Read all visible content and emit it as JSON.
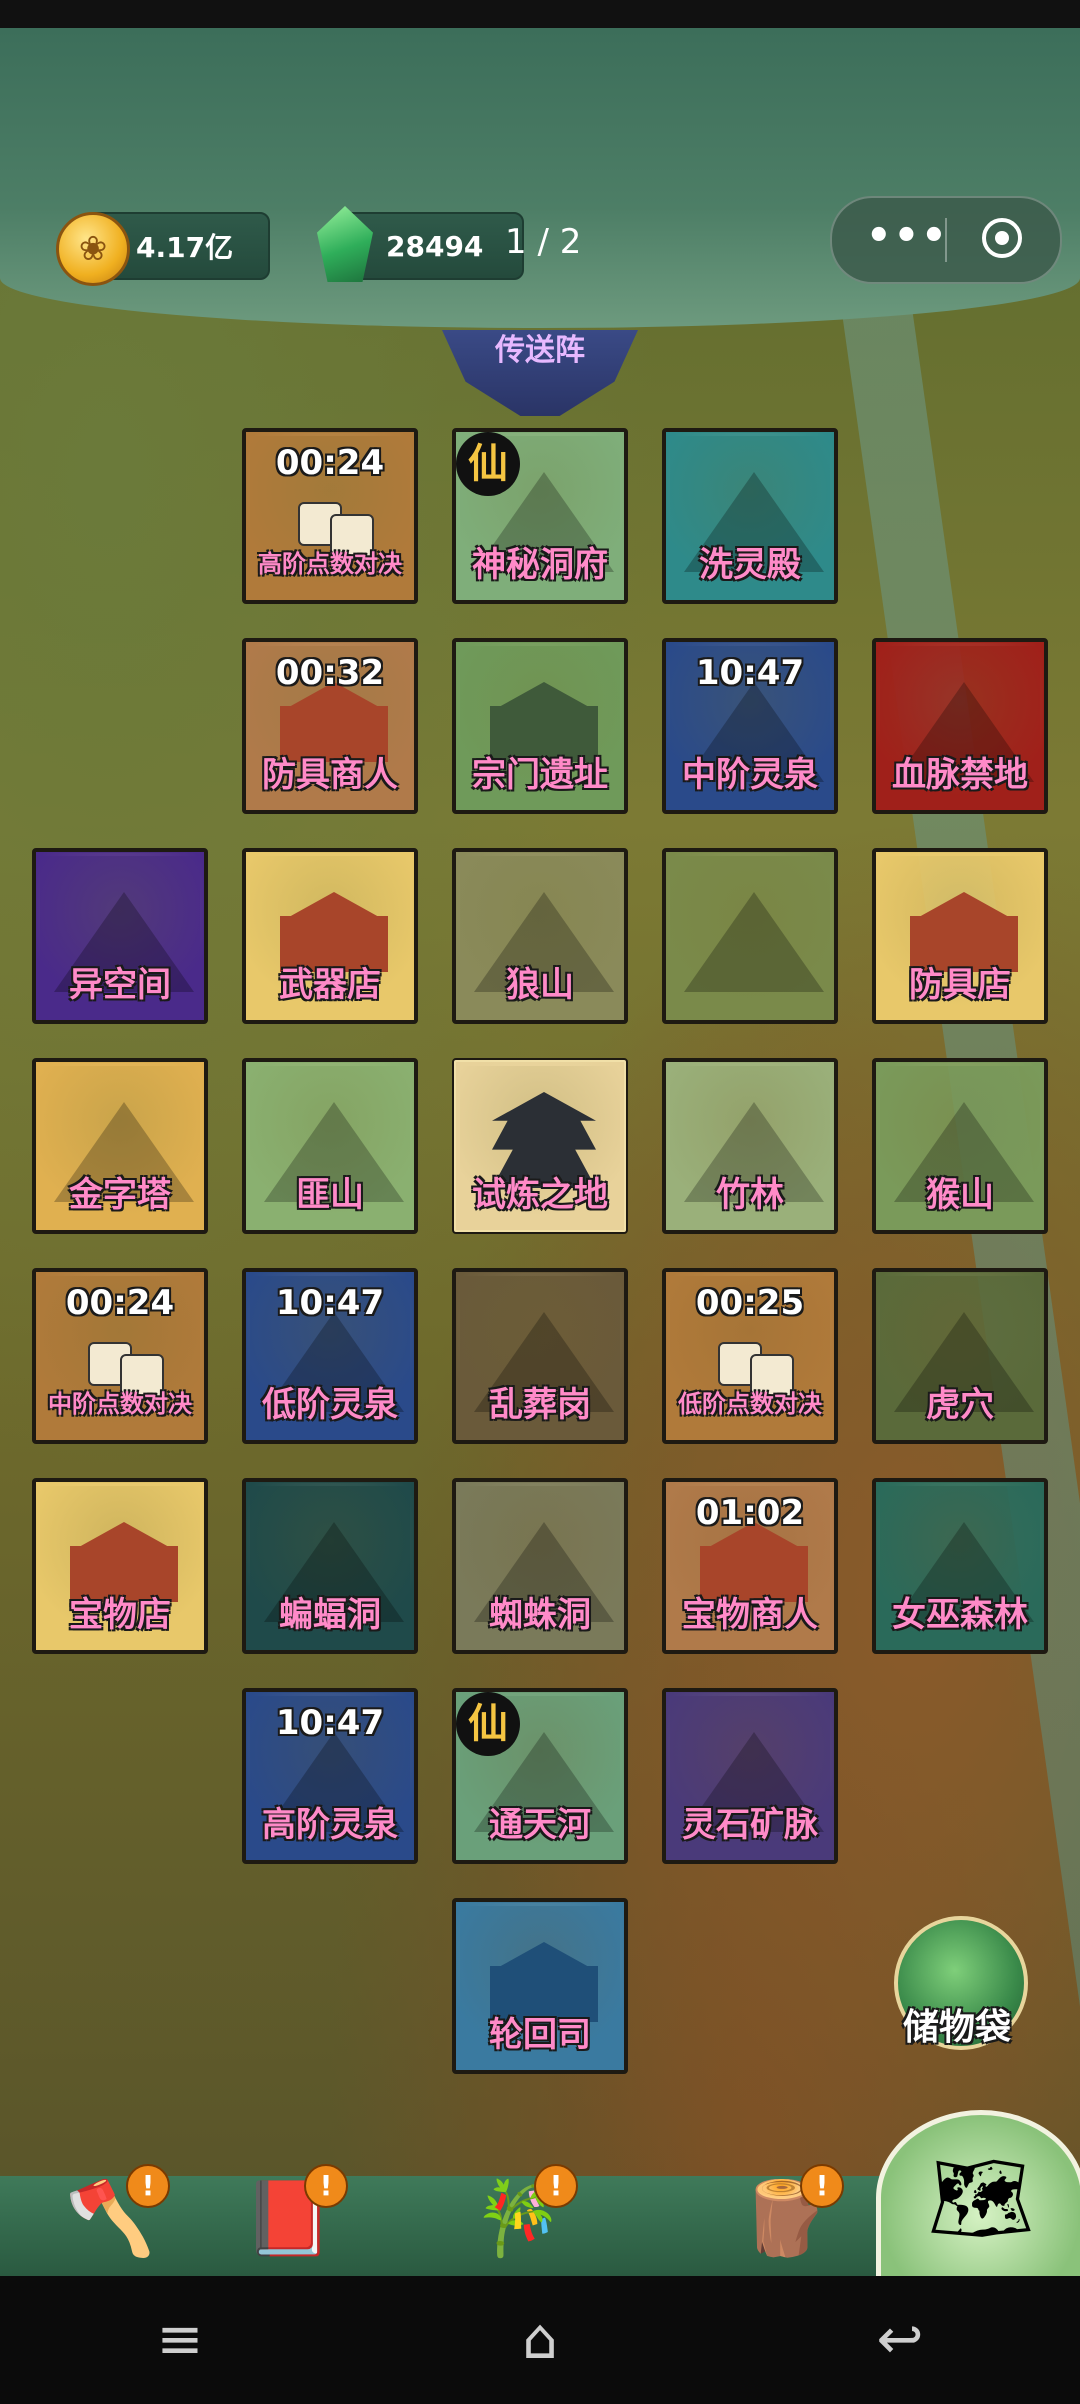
{
  "resources": {
    "coins": "4.17亿",
    "gems": "28494",
    "page": "1 / 2"
  },
  "top_icons": [
    "paw-coin-icon",
    "green-crystal-icon"
  ],
  "capsule": {
    "more_glyph": "•••",
    "target_icon": "target-icon"
  },
  "portal": {
    "label": "传送阵"
  },
  "tiles": [
    {
      "label": "高阶点数对决",
      "timer": "00:24",
      "small": true,
      "art": "dice",
      "color": "#b07a3a"
    },
    {
      "label": "神秘洞府",
      "badge": "仙",
      "art": "mountain",
      "color": "#7fae7a"
    },
    {
      "label": "洗灵殿",
      "art": "crystal",
      "color": "#2e8a8a"
    },
    {
      "label": "防具商人",
      "timer": "00:32",
      "art": "stall",
      "color": "#b07a4a"
    },
    {
      "label": "宗门遗址",
      "art": "gate",
      "color": "#6f9a5a"
    },
    {
      "label": "中阶灵泉",
      "timer": "10:47",
      "art": "waterfall",
      "color": "#2a4a8a"
    },
    {
      "label": "血脉禁地",
      "art": "redpeak",
      "color": "#a0201a"
    },
    {
      "label": "异空间",
      "art": "space",
      "color": "#4a2a8a"
    },
    {
      "label": "武器店",
      "art": "shop",
      "color": "#e8c86a"
    },
    {
      "label": "狼山",
      "art": "mountain",
      "color": "#8a8a5a"
    },
    {
      "label": "",
      "art": "forest",
      "color": "#7a8a4a"
    },
    {
      "label": "防具店",
      "art": "shop",
      "color": "#e8c86a"
    },
    {
      "label": "金字塔",
      "art": "pyramid",
      "color": "#e0b050"
    },
    {
      "label": "匪山",
      "art": "tower",
      "color": "#8ab070"
    },
    {
      "label": "试炼之地",
      "art": "trial",
      "color": "#e8d29a"
    },
    {
      "label": "竹林",
      "art": "bamboo",
      "color": "#9ab07a"
    },
    {
      "label": "猴山",
      "art": "mountain",
      "color": "#7a9a5a"
    },
    {
      "label": "中阶点数对决",
      "timer": "00:24",
      "small": true,
      "art": "dice",
      "color": "#b07a3a"
    },
    {
      "label": "低阶灵泉",
      "timer": "10:47",
      "art": "waterfall",
      "color": "#2a4a8a"
    },
    {
      "label": "乱葬岗",
      "art": "grave",
      "color": "#6a5a3a"
    },
    {
      "label": "低阶点数对决",
      "timer": "00:25",
      "small": true,
      "art": "dice",
      "color": "#b07a3a"
    },
    {
      "label": "虎穴",
      "art": "cave",
      "color": "#5a6a3a"
    },
    {
      "label": "宝物店",
      "art": "shop",
      "color": "#e8c86a"
    },
    {
      "label": "蝙蝠洞",
      "art": "cave",
      "color": "#1f4a4a"
    },
    {
      "label": "蜘蛛洞",
      "art": "spider",
      "color": "#7a7a5a"
    },
    {
      "label": "宝物商人",
      "timer": "01:02",
      "art": "stall",
      "color": "#b07a4a"
    },
    {
      "label": "女巫森林",
      "art": "forest",
      "color": "#2a6a5a"
    },
    {
      "label": "高阶灵泉",
      "timer": "10:47",
      "art": "waterfall",
      "color": "#2a4a8a"
    },
    {
      "label": "通天河",
      "badge": "仙",
      "art": "river",
      "color": "#6aa07a"
    },
    {
      "label": "灵石矿脉",
      "art": "crystal",
      "color": "#4a3a7a"
    },
    {
      "label": "轮回司",
      "art": "temple",
      "color": "#3a7aa0"
    }
  ],
  "bag": {
    "label": "储物袋"
  },
  "toolbar": {
    "items": [
      {
        "icon": "axe-icon",
        "glyph": "🪓",
        "alert": "!"
      },
      {
        "icon": "book-icon",
        "glyph": "📕",
        "alert": "!"
      },
      {
        "icon": "gourd-scroll-icon",
        "glyph": "🎋",
        "alert": "!"
      },
      {
        "icon": "wood-log-icon",
        "glyph": "🪵",
        "alert": "!"
      }
    ],
    "main_icon": "map-scroll-icon"
  },
  "navbar": {
    "menu_glyph": "≡",
    "home_glyph": "⌂",
    "back_glyph": "↩"
  }
}
